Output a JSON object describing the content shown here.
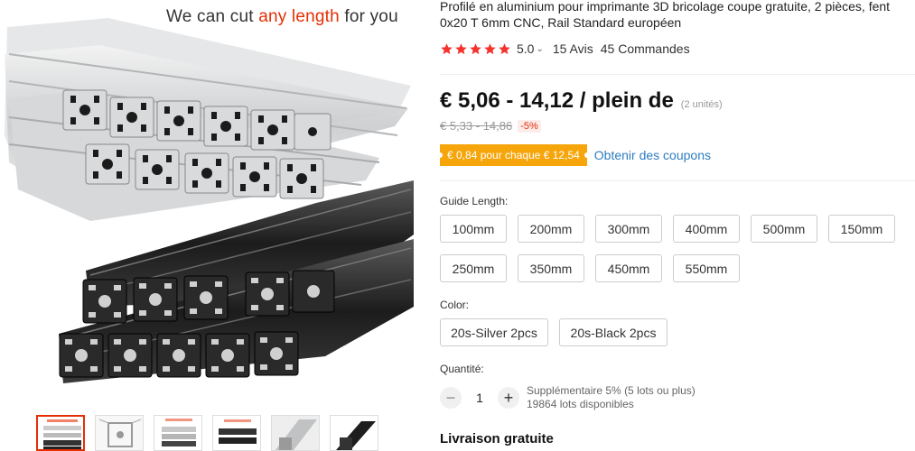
{
  "gallery": {
    "banner_prefix": "We can cut ",
    "banner_highlight": "any length",
    "banner_suffix": " for you",
    "thumbnails": [
      "thumb-1",
      "thumb-2",
      "thumb-3",
      "thumb-4",
      "thumb-5",
      "thumb-6"
    ],
    "active_thumbnail": 0
  },
  "product": {
    "title_line1": "Profilé en aluminium pour imprimante 3D bricolage coupe gratuite, 2 pièces, fent",
    "title_line2": "0x20 T 6mm CNC, Rail Standard européen"
  },
  "rating": {
    "stars": 5,
    "score": "5.0",
    "chevron": "⌄",
    "reviews": "15 Avis",
    "orders": "45 Commandes",
    "star_color": "#f5322d"
  },
  "price": {
    "main": "€ 5,06 - 14,12 / plein de",
    "unit_note": "(2 unités)",
    "original": "€ 5,33 - 14,86",
    "discount": "-5%"
  },
  "coupon": {
    "badge": "€ 0,84 pour chaque € 12,54",
    "link": "Obtenir des coupons",
    "badge_color": "#f6a60b"
  },
  "guide_length": {
    "label": "Guide Length:",
    "options": [
      "100mm",
      "200mm",
      "300mm",
      "400mm",
      "500mm",
      "150mm",
      "250mm",
      "350mm",
      "450mm",
      "550mm"
    ]
  },
  "color": {
    "label": "Color:",
    "options": [
      "20s-Silver 2pcs",
      "20s-Black 2pcs"
    ]
  },
  "quantity": {
    "label": "Quantité:",
    "minus": "−",
    "value": "1",
    "plus": "+",
    "info_line1": "Supplémentaire 5% (5 lots ou plus)",
    "info_line2": "19864 lots disponibles"
  },
  "shipping": {
    "label": "Livraison gratuite"
  }
}
